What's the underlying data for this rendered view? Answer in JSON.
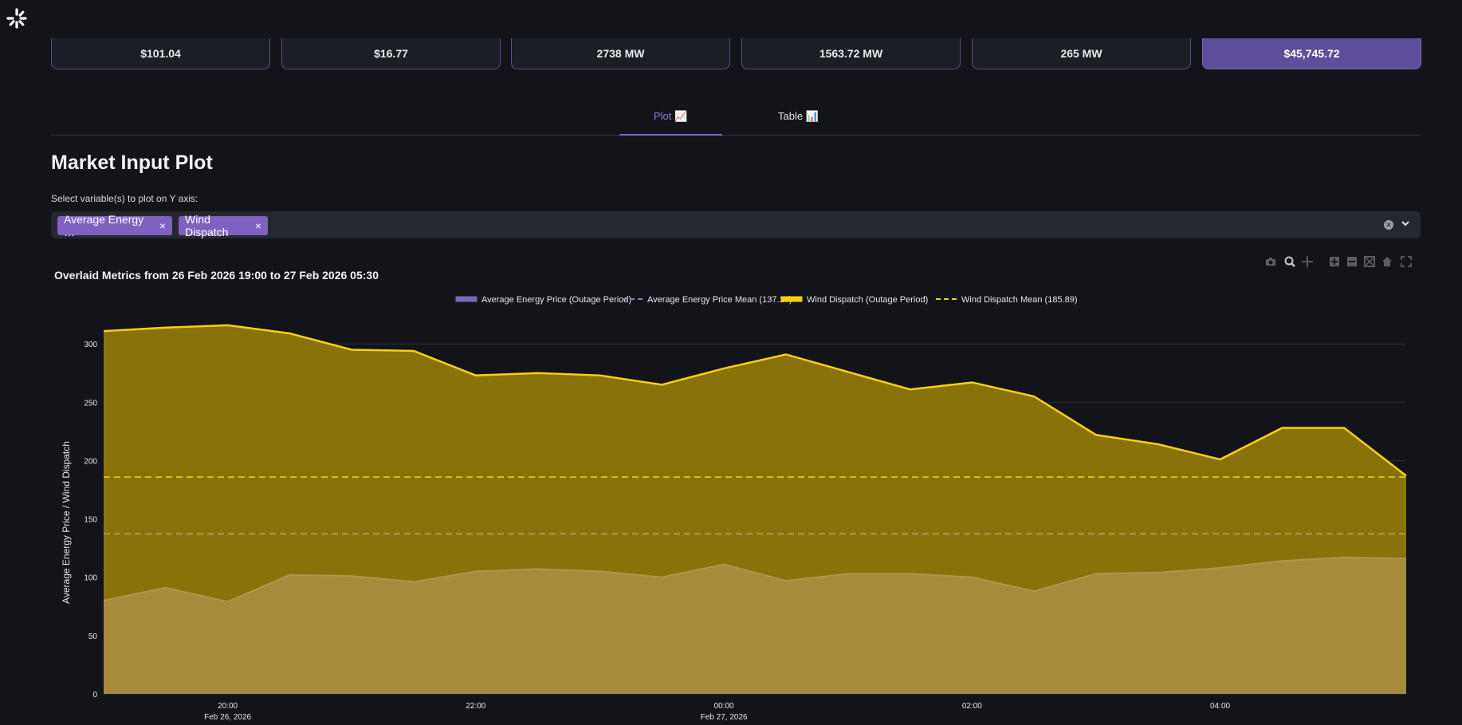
{
  "metrics": [
    "$101.04",
    "$16.77",
    "2738 MW",
    "1563.72 MW",
    "265 MW",
    "$45,745.72"
  ],
  "tabs": [
    {
      "label": "Plot 📈",
      "active": true
    },
    {
      "label": "Table 📊",
      "active": false
    }
  ],
  "page_title": "Market Input Plot",
  "select_label": "Select variable(s) to plot on Y axis:",
  "selected_chips": [
    "Average Energy …",
    "Wind Dispatch"
  ],
  "chip_remove_glyph": "×",
  "icons": {
    "logo": "app-logo-icon",
    "clear": "clear-all-icon",
    "dropdown": "chevron-down-icon",
    "modebar": [
      "camera-icon",
      "zoom-icon",
      "pan-icon",
      "zoom-in-icon",
      "zoom-out-icon",
      "autoscale-icon",
      "home-icon",
      "fullscreen-icon"
    ]
  },
  "colors": {
    "accent": "#7a64d0",
    "chip": "#8061bf",
    "price_line": "#9b87c9",
    "wind_line": "#f5d20c",
    "wind_fill": "#8a720b",
    "price_fill": "#a88a3c"
  },
  "chart_data": {
    "type": "area",
    "title": "Overlaid Metrics from 26 Feb 2026 19:00 to 27 Feb 2026 05:30",
    "ylabel": "Average Energy Price / Wind Dispatch",
    "xlabel": "",
    "ylim": [
      0,
      335
    ],
    "yticks": [
      0,
      50,
      100,
      150,
      200,
      250,
      300
    ],
    "grid": true,
    "legend_position": "top",
    "x": [
      "19:00",
      "19:30",
      "20:00",
      "20:30",
      "21:00",
      "21:30",
      "22:00",
      "22:30",
      "23:00",
      "23:30",
      "00:00",
      "00:30",
      "01:00",
      "01:30",
      "02:00",
      "02:30",
      "03:00",
      "03:30",
      "04:00",
      "04:30",
      "05:00",
      "05:30"
    ],
    "xtick_labels": [
      {
        "at": "20:00",
        "line1": "20:00",
        "line2": "Feb 26, 2026"
      },
      {
        "at": "22:00",
        "line1": "22:00",
        "line2": ""
      },
      {
        "at": "00:00",
        "line1": "00:00",
        "line2": "Feb 27, 2026"
      },
      {
        "at": "02:00",
        "line1": "02:00",
        "line2": ""
      },
      {
        "at": "04:00",
        "line1": "04:00",
        "line2": ""
      }
    ],
    "series": [
      {
        "name": "Average Energy Price (Outage Period)",
        "kind": "area",
        "values": [
          80,
          91,
          79,
          102,
          101,
          96,
          105,
          107,
          105,
          100,
          111,
          97,
          103,
          103,
          100,
          88,
          103,
          104,
          108,
          114,
          117,
          116
        ]
      },
      {
        "name": "Average Energy Price Mean (137.17)",
        "kind": "mean-line",
        "value": 137.17
      },
      {
        "name": "Wind Dispatch (Outage Period)",
        "kind": "area",
        "values": [
          311,
          314,
          316,
          309,
          295,
          294,
          273,
          275,
          273,
          265,
          279,
          291,
          276,
          261,
          267,
          255,
          222,
          214,
          201,
          228,
          228,
          187
        ]
      },
      {
        "name": "Wind Dispatch Mean (185.89)",
        "kind": "mean-line",
        "value": 185.89
      }
    ]
  }
}
